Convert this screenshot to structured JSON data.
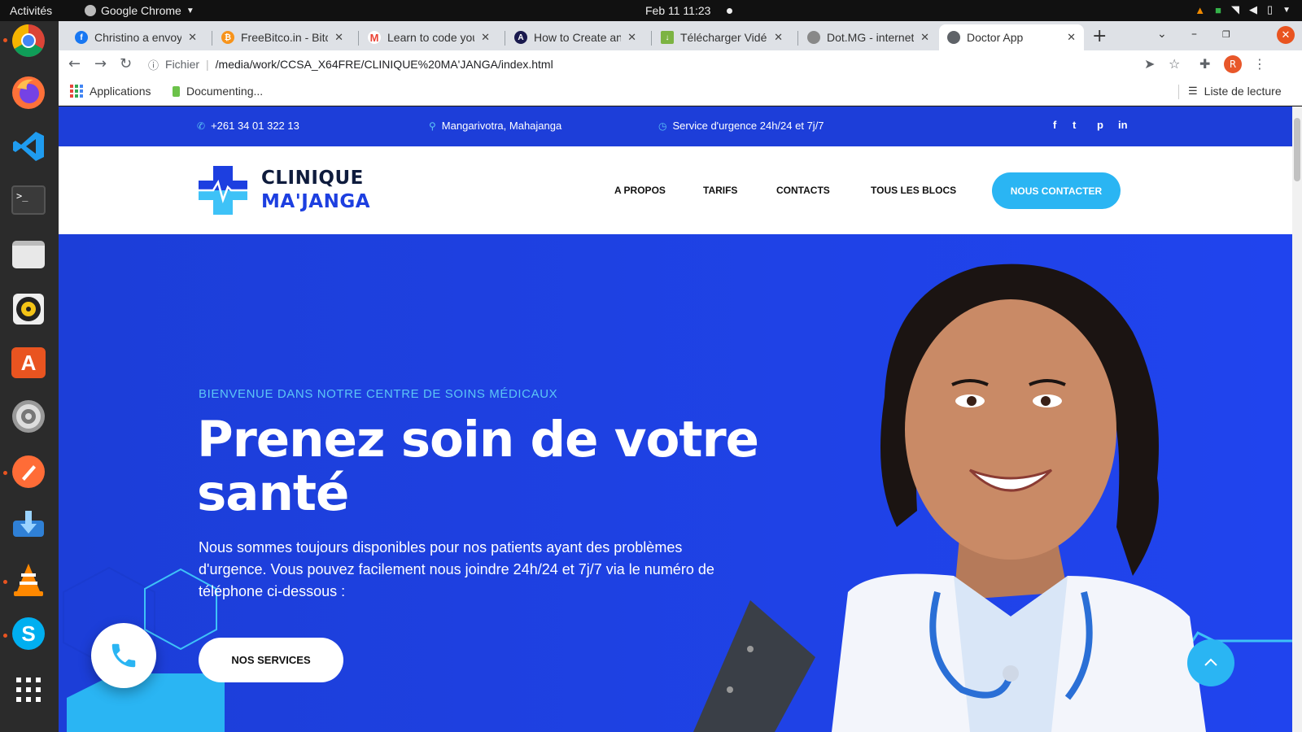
{
  "os_bar": {
    "activities": "Activités",
    "app_name": "Google Chrome",
    "clock": "Feb 11  11:23"
  },
  "browser": {
    "tabs": [
      {
        "title": "Christino a envoyé",
        "favicon": "facebook-icon",
        "color": "#1877f2"
      },
      {
        "title": "FreeBitco.in - Bitcoin",
        "favicon": "bitcoin-icon",
        "color": "#f7931a"
      },
      {
        "title": "Learn to code your",
        "favicon": "gmail-icon",
        "color": "#ea4335"
      },
      {
        "title": "How to Create an",
        "favicon": "angular-icon",
        "color": "#1a1a4e"
      },
      {
        "title": "Télécharger Vidéo",
        "favicon": "download-icon",
        "color": "#7cb342"
      },
      {
        "title": "Dot.MG - internet",
        "favicon": "globe-icon",
        "color": "#777777"
      },
      {
        "title": "Doctor App",
        "favicon": "globe-icon",
        "color": "#5f6368"
      }
    ],
    "url_scheme": "Fichier",
    "url": "/media/work/CCSA_X64FRE/CLINIQUE%20MA'JANGA/index.html",
    "profile_initial": "R",
    "bookmarks": {
      "apps": "Applications",
      "documenting": "Documenting...",
      "reading_list": "Liste de lecture"
    }
  },
  "site": {
    "infobar": {
      "phone": "+261 34 01 322 13",
      "address": "Mangarivotra, Mahajanga",
      "emergency": "Service d'urgence 24h/24 et 7j/7",
      "social": [
        "f",
        "t",
        "p",
        "in"
      ]
    },
    "brand": {
      "line1": "CLINIQUE",
      "line2": "MA'JANGA"
    },
    "nav": [
      "A PROPOS",
      "TARIFS",
      "CONTACTS",
      "TOUS LES BLOCS"
    ],
    "cta": "NOUS CONTACTER",
    "hero": {
      "kicker": "BIENVENUE DANS NOTRE CENTRE DE SOINS MÉDICAUX",
      "title_line1": "Prenez soin de votre",
      "title_line2": "santé",
      "description": "Nous sommes toujours disponibles pour nos patients ayant des problèmes d'urgence. Vous pouvez facilement nous joindre 24h/24 et 7j/7 via le numéro de téléphone ci-dessous :",
      "button": "NOS SERVICES"
    }
  },
  "colors": {
    "brand_blue": "#1d3fe0",
    "accent_cyan": "#2ab5f3",
    "navy": "#0f1c3d"
  }
}
